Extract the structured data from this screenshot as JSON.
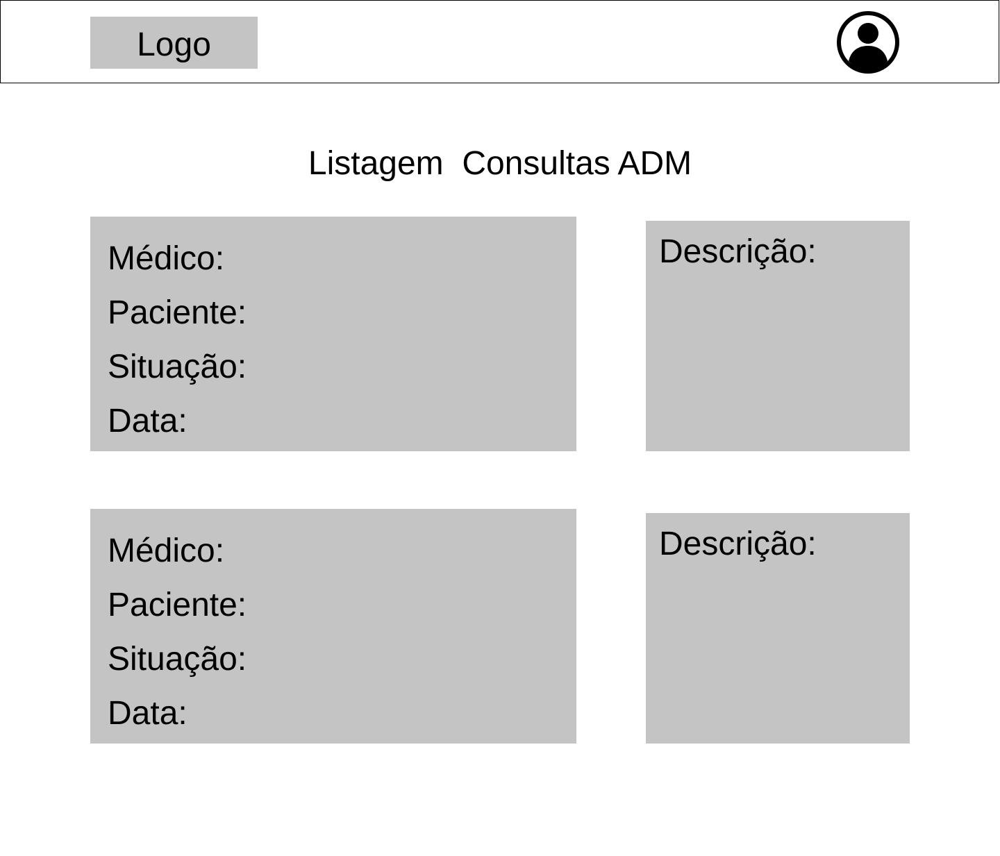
{
  "header": {
    "logo_label": "Logo",
    "avatar_icon": "user-circle-icon"
  },
  "page": {
    "title": "Listagem  Consultas ADM"
  },
  "consultations": [
    {
      "medico_label": "Médico:",
      "paciente_label": "Paciente:",
      "situacao_label": "Situação:",
      "data_label": "Data:",
      "descricao_label": "Descrição:"
    },
    {
      "medico_label": "Médico:",
      "paciente_label": "Paciente:",
      "situacao_label": "Situação:",
      "data_label": "Data:",
      "descricao_label": "Descrição:"
    }
  ],
  "colors": {
    "card_background": "#c4c4c4",
    "border": "#000000",
    "page_background": "#ffffff"
  }
}
